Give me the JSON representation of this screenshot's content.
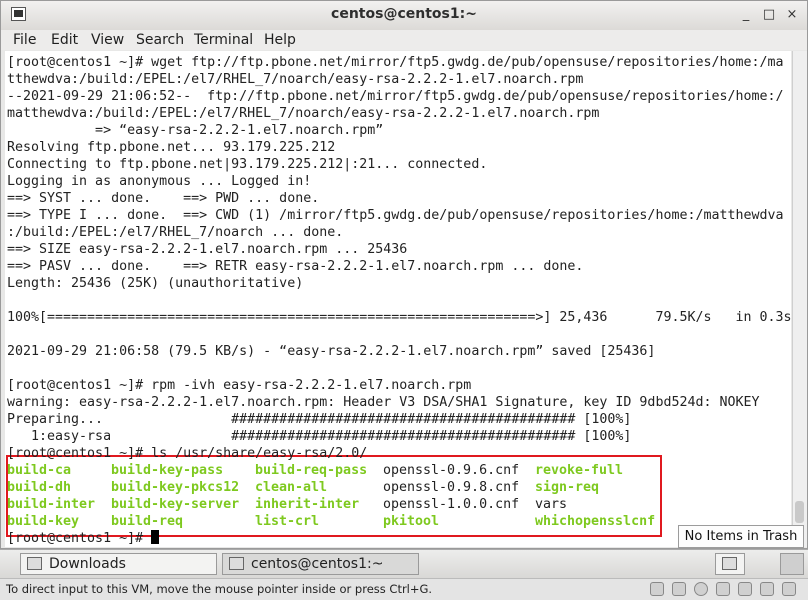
{
  "window": {
    "title": "centos@centos1:~",
    "min_glyph": "_",
    "max_glyph": "□",
    "close_glyph": "×"
  },
  "menu": [
    "File",
    "Edit",
    "View",
    "Search",
    "Terminal",
    "Help"
  ],
  "terminal": {
    "lines": [
      "[root@centos1 ~]# wget ftp://ftp.pbone.net/mirror/ftp5.gwdg.de/pub/opensuse/repositories/home:/ma",
      "tthewdva:/build:/EPEL:/el7/RHEL_7/noarch/easy-rsa-2.2.2-1.el7.noarch.rpm",
      "--2021-09-29 21:06:52--  ftp://ftp.pbone.net/mirror/ftp5.gwdg.de/pub/opensuse/repositories/home:/",
      "matthewdva:/build:/EPEL:/el7/RHEL_7/noarch/easy-rsa-2.2.2-1.el7.noarch.rpm",
      "           => “easy-rsa-2.2.2-1.el7.noarch.rpm”",
      "Resolving ftp.pbone.net... 93.179.225.212",
      "Connecting to ftp.pbone.net|93.179.225.212|:21... connected.",
      "Logging in as anonymous ... Logged in!",
      "==> SYST ... done.    ==> PWD ... done.",
      "==> TYPE I ... done.  ==> CWD (1) /mirror/ftp5.gwdg.de/pub/opensuse/repositories/home:/matthewdva",
      ":/build:/EPEL:/el7/RHEL_7/noarch ... done.",
      "==> SIZE easy-rsa-2.2.2-1.el7.noarch.rpm ... 25436",
      "==> PASV ... done.    ==> RETR easy-rsa-2.2.2-1.el7.noarch.rpm ... done.",
      "Length: 25436 (25K) (unauthoritative)",
      "",
      "100%[=============================================================>] 25,436      79.5K/s   in 0.3s",
      "",
      "2021-09-29 21:06:58 (79.5 KB/s) - “easy-rsa-2.2.2-1.el7.noarch.rpm” saved [25436]",
      "",
      "[root@centos1 ~]# rpm -ivh easy-rsa-2.2.2-1.el7.noarch.rpm",
      "warning: easy-rsa-2.2.2-1.el7.noarch.rpm: Header V3 DSA/SHA1 Signature, key ID 9dbd524d: NOKEY",
      "Preparing...                ########################################### [100%]",
      "   1:easy-rsa               ########################################### [100%]",
      "[root@centos1 ~]# ls /usr/share/easy-rsa/2.0/"
    ],
    "ls_rows": [
      [
        {
          "t": "build-ca",
          "g": true
        },
        {
          "t": "build-key-pass",
          "g": true
        },
        {
          "t": "build-req-pass",
          "g": true
        },
        {
          "t": "openssl-0.9.6.cnf",
          "g": false
        },
        {
          "t": "revoke-full",
          "g": true
        }
      ],
      [
        {
          "t": "build-dh",
          "g": true
        },
        {
          "t": "build-key-pkcs12",
          "g": true
        },
        {
          "t": "clean-all",
          "g": true
        },
        {
          "t": "openssl-0.9.8.cnf",
          "g": false
        },
        {
          "t": "sign-req",
          "g": true
        }
      ],
      [
        {
          "t": "build-inter",
          "g": true
        },
        {
          "t": "build-key-server",
          "g": true
        },
        {
          "t": "inherit-inter",
          "g": true
        },
        {
          "t": "openssl-1.0.0.cnf",
          "g": false
        },
        {
          "t": "vars",
          "g": false
        }
      ],
      [
        {
          "t": "build-key",
          "g": true
        },
        {
          "t": "build-req",
          "g": true
        },
        {
          "t": "list-crl",
          "g": true
        },
        {
          "t": "pkitool",
          "g": true
        },
        {
          "t": "whichopensslcnf",
          "g": true
        }
      ]
    ],
    "prompt": "[root@centos1 ~]# "
  },
  "trash_tooltip": "No Items in Trash",
  "taskbar": {
    "downloads": "Downloads",
    "terminal": "centos@centos1:~"
  },
  "statusbar": "To direct input to this VM, move the mouse pointer inside or press Ctrl+G.",
  "colors": {
    "exec_green": "#7ec91f",
    "highlight_red": "#e0191f"
  }
}
